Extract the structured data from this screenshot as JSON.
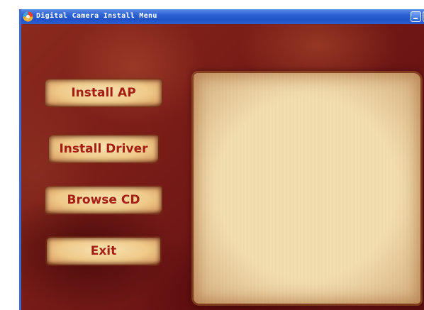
{
  "window": {
    "title": "Digital Camera Install Menu"
  },
  "menu": {
    "buttons": [
      {
        "label": "Install AP"
      },
      {
        "label": "Install Driver"
      },
      {
        "label": "Browse CD"
      },
      {
        "label": "Exit"
      }
    ]
  },
  "icons": {
    "app": "camera-app-icon",
    "minimize": "minimize-icon",
    "maximize": "maximize-icon"
  },
  "colors": {
    "titlebar": "#2a5fd2",
    "background": "#7a1d18",
    "button_text": "#a51e14",
    "parchment": "#f3deb0"
  }
}
